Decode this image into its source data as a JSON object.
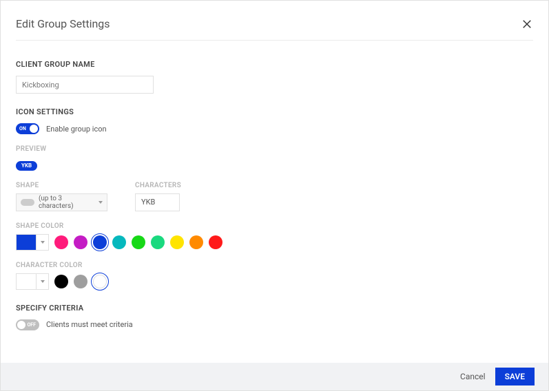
{
  "header": {
    "title": "Edit Group Settings"
  },
  "sections": {
    "group_name": {
      "label": "CLIENT GROUP NAME",
      "value": "Kickboxing"
    },
    "icon_settings": {
      "label": "ICON SETTINGS",
      "toggle_state": "ON",
      "toggle_text": "Enable group icon"
    },
    "preview": {
      "label": "PREVIEW",
      "badge": "YKB"
    },
    "shape": {
      "label": "SHAPE",
      "select_text": "(up to 3 characters)"
    },
    "characters": {
      "label": "CHARACTERS",
      "value": "YKB"
    },
    "shape_color": {
      "label": "SHAPE COLOR",
      "selected": "#0c3ed8",
      "swatches": [
        "#ff1b7b",
        "#c41cc4",
        "#0c3ed8",
        "#06b8bd",
        "#17d817",
        "#1ad97f",
        "#ffe400",
        "#ff8a00",
        "#ff1a1a"
      ],
      "selected_index": 2
    },
    "character_color": {
      "label": "CHARACTER COLOR",
      "selected": "#ffffff",
      "swatches": [
        "#000000",
        "#9e9e9e",
        "#ffffff"
      ],
      "selected_index": 2
    },
    "criteria": {
      "label": "SPECIFY CRITERIA",
      "toggle_state": "OFF",
      "toggle_text": "Clients must meet criteria"
    }
  },
  "footer": {
    "cancel": "Cancel",
    "save": "SAVE"
  }
}
